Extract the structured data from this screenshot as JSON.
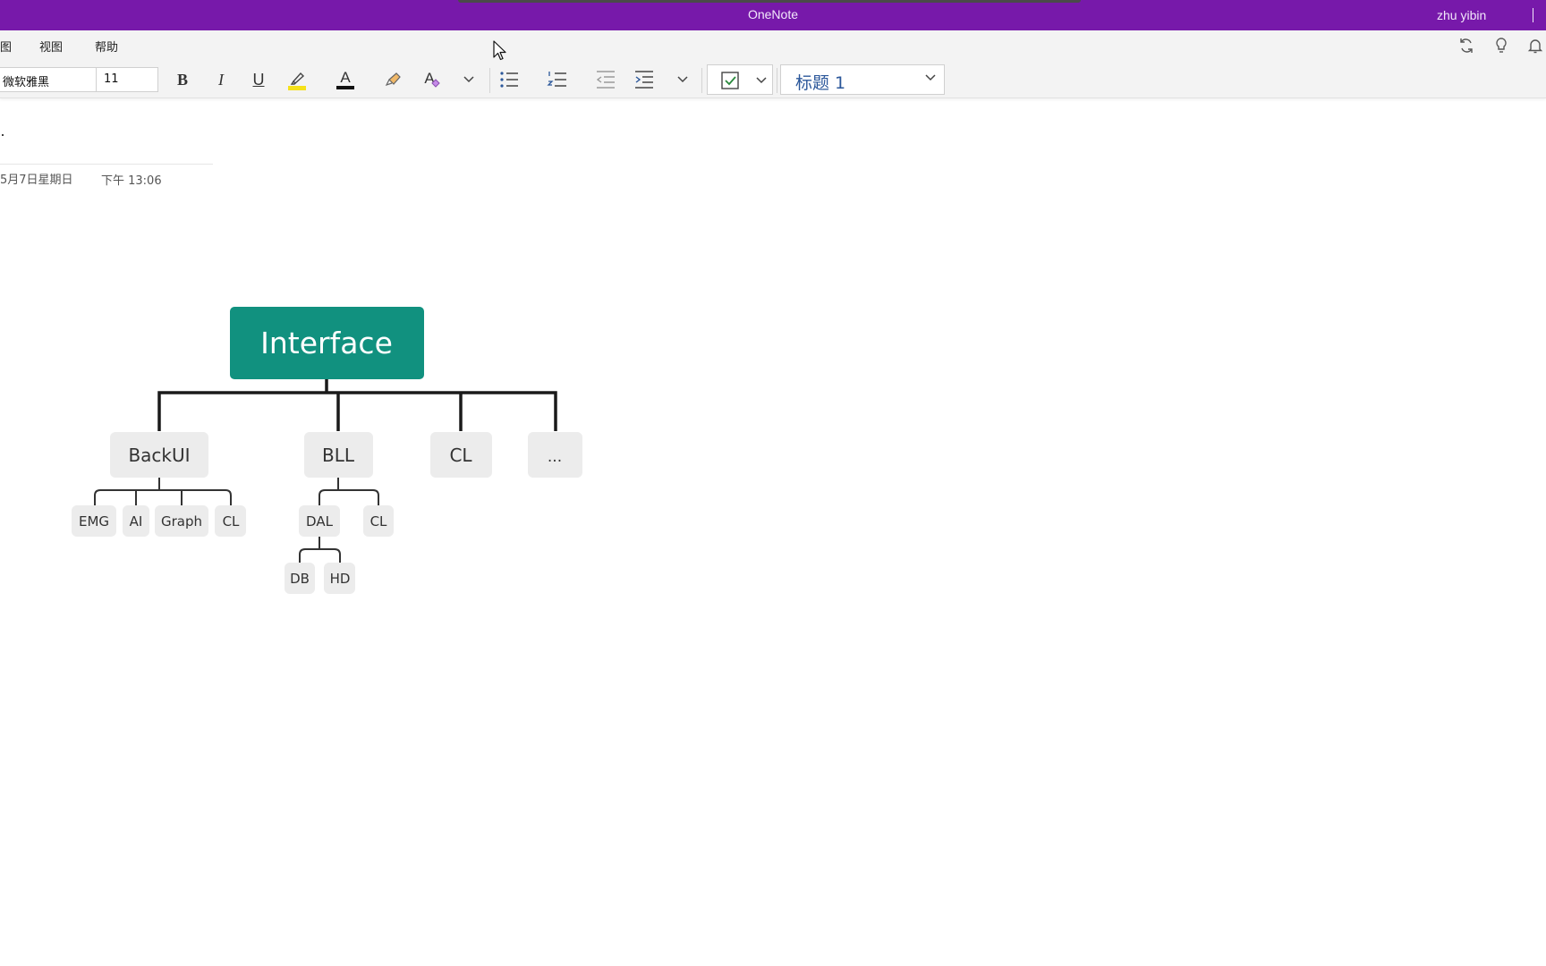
{
  "window": {
    "title": "OneNote",
    "user": "zhu yibin"
  },
  "menu": {
    "items": [
      "图",
      "视图",
      "帮助"
    ]
  },
  "toolbar": {
    "font_name": "微软雅黑",
    "font_size": "11",
    "bold_glyph": "B",
    "italic_glyph": "I",
    "underline_glyph": "U",
    "font_color_glyph": "A",
    "clear_format_glyph": "A",
    "style_value": "标题 1",
    "colors": {
      "highlight": "#f5e11a",
      "font_color": "#111111",
      "accent": "#7719aa"
    },
    "right_icons": [
      "sync-icon",
      "lightbulb-icon",
      "bell-icon"
    ]
  },
  "page": {
    "title_mark": "·",
    "date": "5月7日星期日",
    "time": "下午 13:06"
  },
  "mindmap": {
    "root": "Interface",
    "root_color": "#11917f",
    "level1": [
      "BackUI",
      "BLL",
      "CL",
      "..."
    ],
    "backui_children": [
      "EMG",
      "AI",
      "Graph",
      "CL"
    ],
    "bll_children": [
      "DAL",
      "CL"
    ],
    "dal_children": [
      "DB",
      "HD"
    ]
  }
}
